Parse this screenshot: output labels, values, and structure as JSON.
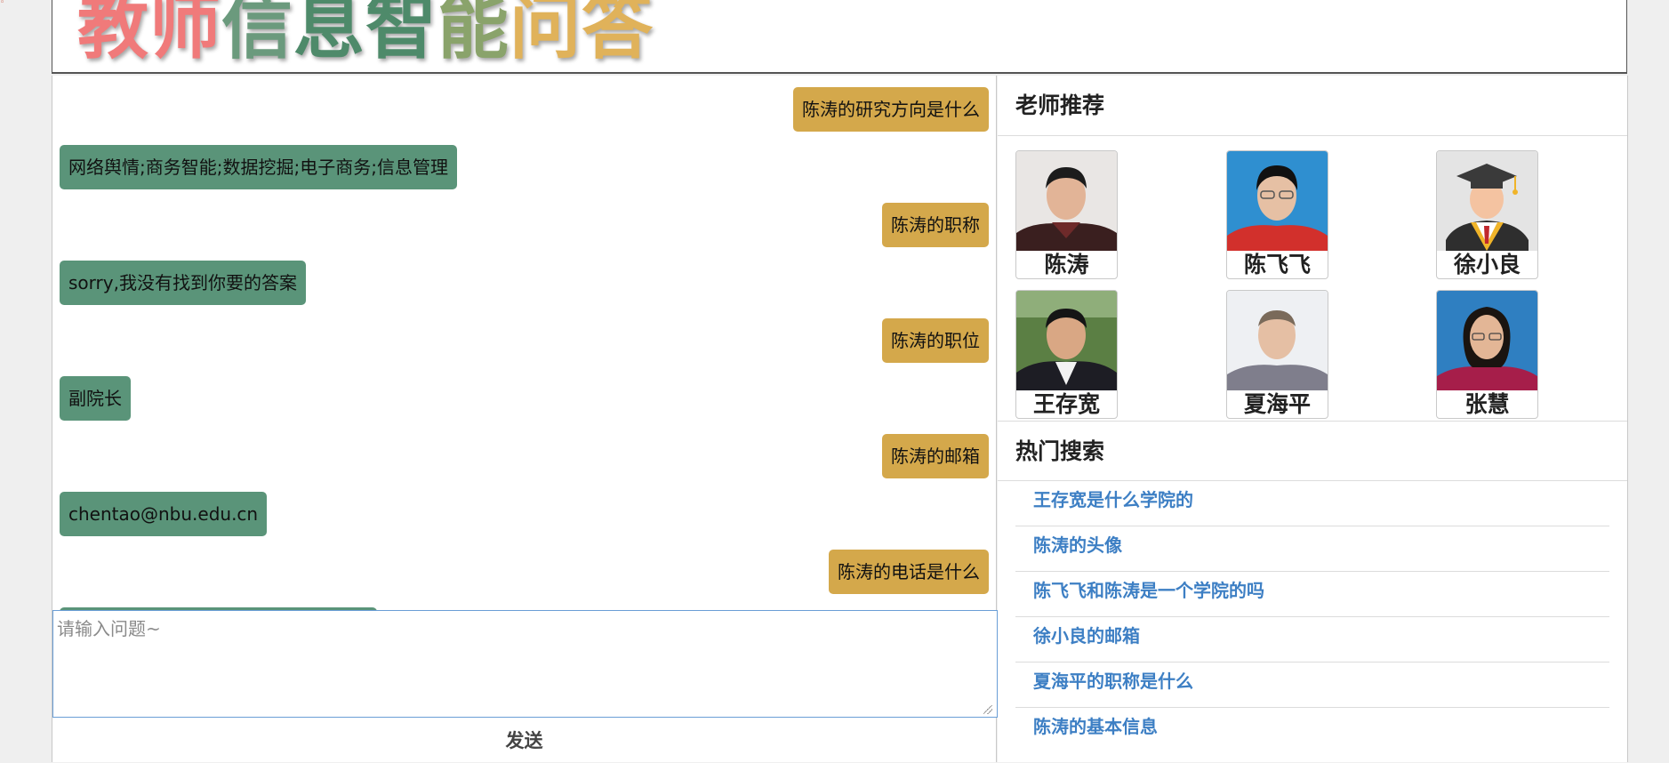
{
  "header": {
    "logo_chars": [
      {
        "char": "教",
        "color": "#f07a7a"
      },
      {
        "char": "师",
        "color": "#f07a7a"
      },
      {
        "char": "信",
        "color": "#6b9a7d"
      },
      {
        "char": "息",
        "color": "#4e8a6a"
      },
      {
        "char": "智",
        "color": "#4e8a6a"
      },
      {
        "char": "能",
        "color": "#8aa36b"
      },
      {
        "char": "问",
        "color": "#e0b25a"
      },
      {
        "char": "答",
        "color": "#e0b25a"
      }
    ]
  },
  "chat": {
    "messages": [
      {
        "role": "user",
        "text": "陈涛的研究方向是什么"
      },
      {
        "role": "bot",
        "text": "网络舆情;商务智能;数据挖掘;电子商务;信息管理"
      },
      {
        "role": "user",
        "text": "陈涛的职称"
      },
      {
        "role": "bot",
        "text": "sorry,我没有找到你要的答案"
      },
      {
        "role": "user",
        "text": "陈涛的职位"
      },
      {
        "role": "bot",
        "text": "副院长"
      },
      {
        "role": "user",
        "text": "陈涛的邮箱"
      },
      {
        "role": "bot",
        "text": "chentao@nbu.edu.cn"
      },
      {
        "role": "user",
        "text": "陈涛的电话是什么"
      },
      {
        "role": "bot",
        "text": ""
      }
    ],
    "input_placeholder": "请输入问题~",
    "input_value": "",
    "send_label": "发送"
  },
  "sidebar": {
    "recommend_title": "老师推荐",
    "teachers": [
      {
        "name": "陈涛",
        "photo": "teacher-photo-man-dark-jacket"
      },
      {
        "name": "陈飞飞",
        "photo": "teacher-photo-man-blue-background"
      },
      {
        "name": "徐小良",
        "photo": "graduate-avatar-icon"
      },
      {
        "name": "王存宽",
        "photo": "teacher-photo-man-outdoor"
      },
      {
        "name": "夏海平",
        "photo": "teacher-photo-man-gray-shirt"
      },
      {
        "name": "张慧",
        "photo": "teacher-photo-woman-blue-background"
      }
    ],
    "hot_title": "热门搜索",
    "hot_searches": [
      "王存宽是什么学院的",
      "陈涛的头像",
      "陈飞飞和陈涛是一个学院的吗",
      "徐小良的邮箱",
      "夏海平的职称是什么",
      "陈涛的基本信息"
    ]
  },
  "colors": {
    "user_bubble": "#d4a84b",
    "bot_bubble": "#5a9479",
    "link": "#3d7fc4"
  }
}
